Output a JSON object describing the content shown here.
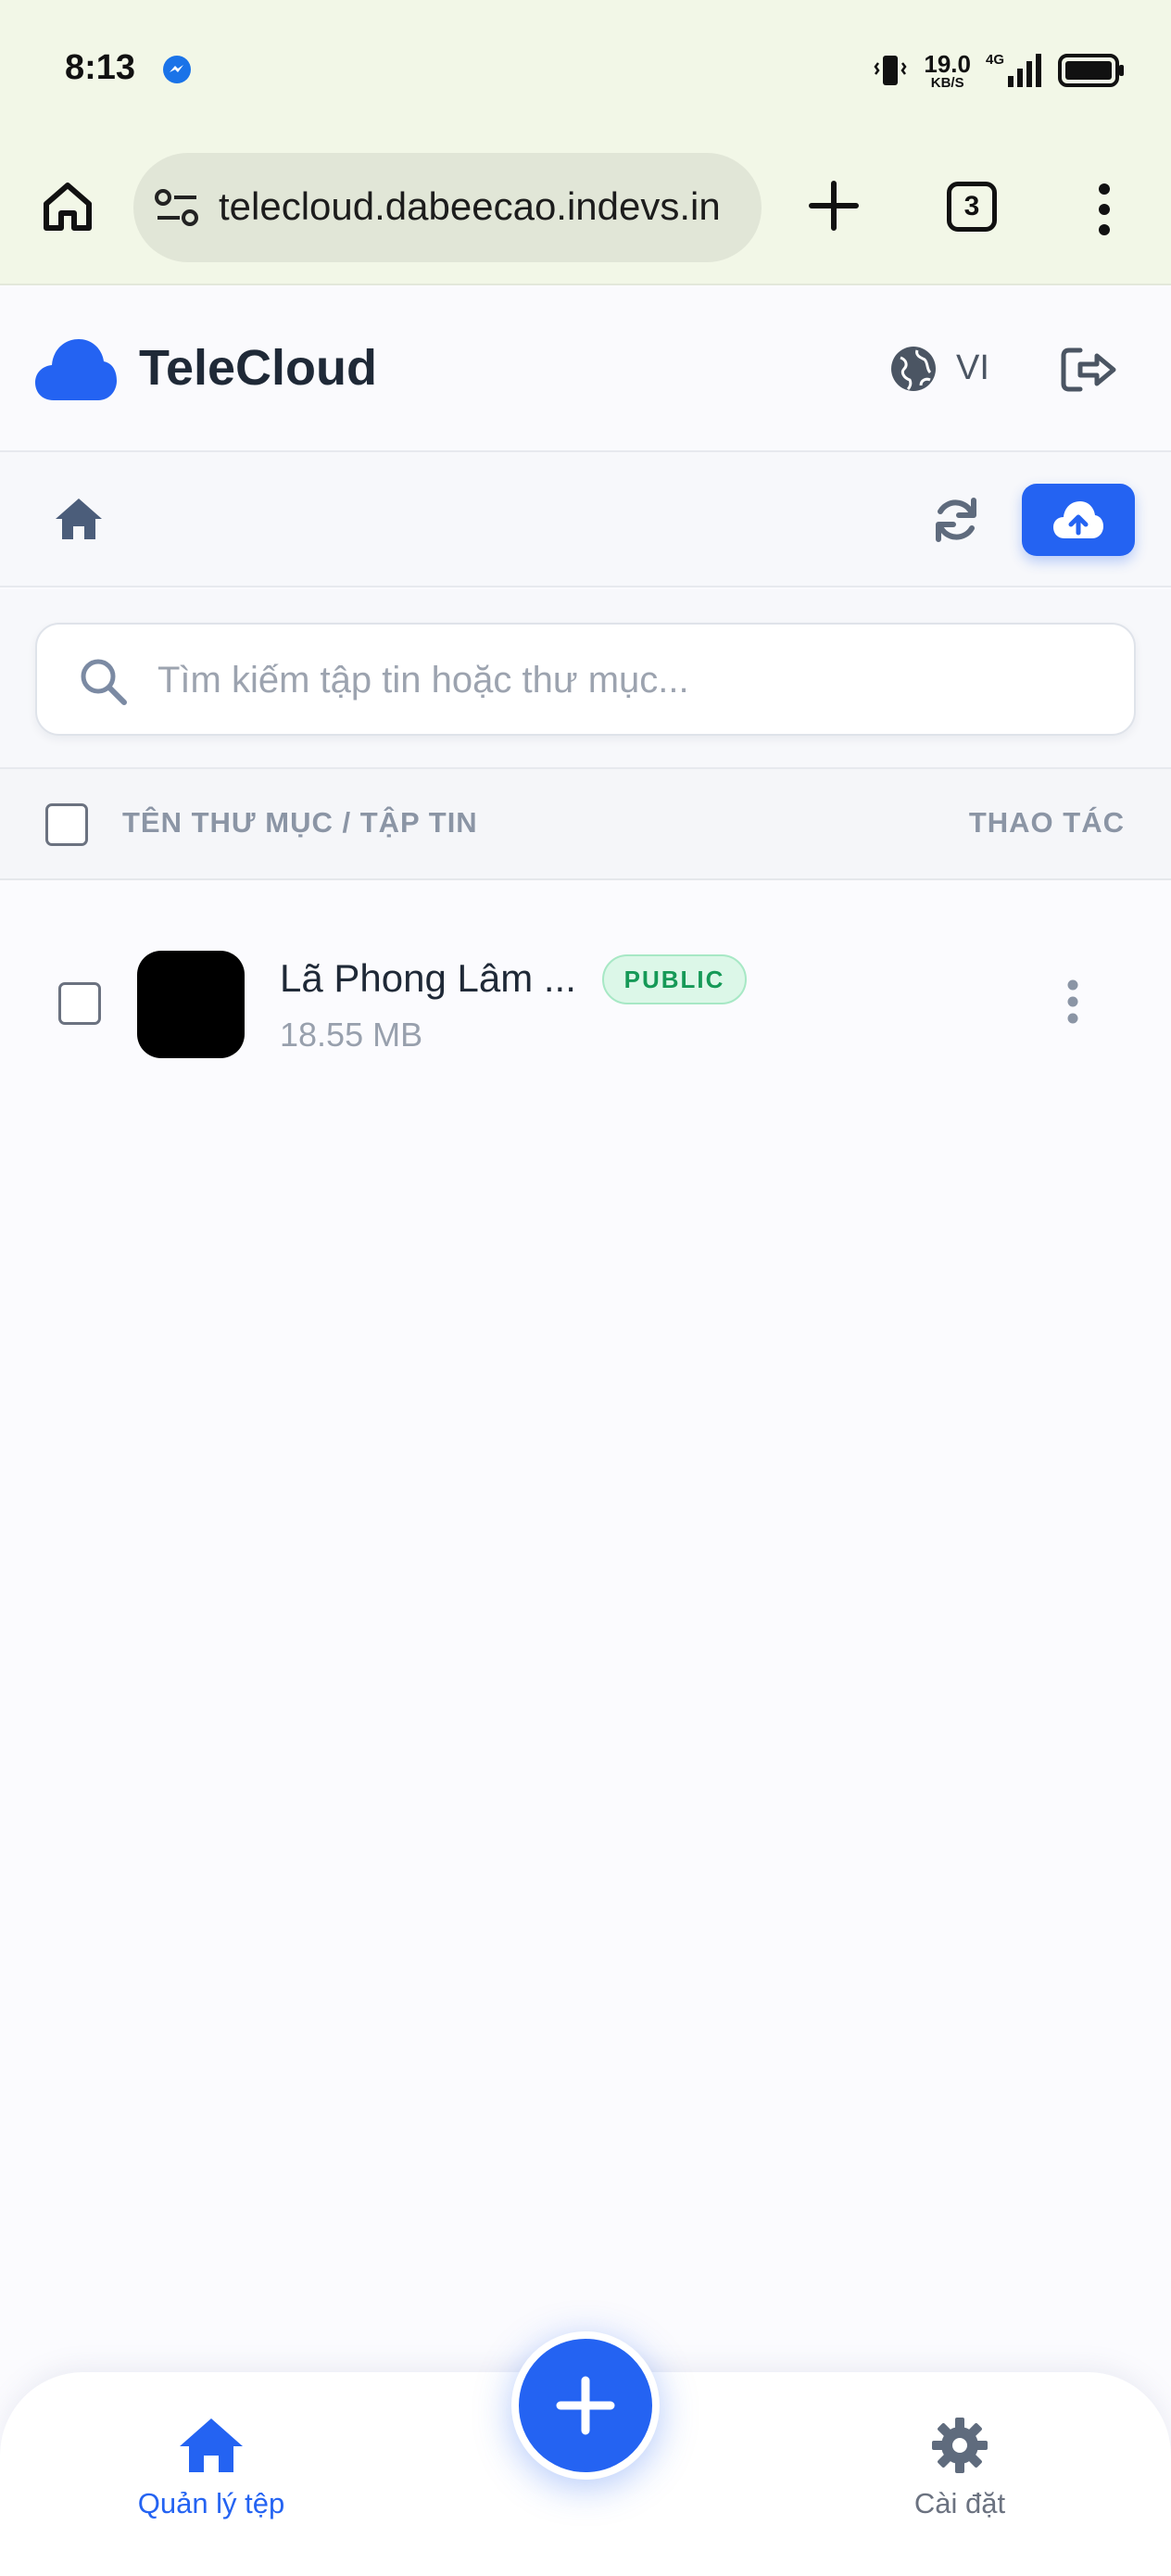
{
  "status_bar": {
    "time": "8:13",
    "net_speed_value": "19.0",
    "net_speed_unit": "KB/S",
    "network_type": "4G"
  },
  "browser": {
    "url": "telecloud.dabeecao.indevs.in",
    "tab_count": "3"
  },
  "header": {
    "brand": "TeleCloud",
    "language": "VI"
  },
  "search": {
    "placeholder": "Tìm kiếm tập tin hoặc thư mục..."
  },
  "table": {
    "col_name": "TÊN THƯ MỤC / TẬP TIN",
    "col_actions": "THAO TÁC",
    "rows": [
      {
        "name": "Lã Phong Lâm ...",
        "badge": "PUBLIC",
        "size": "18.55 MB"
      }
    ]
  },
  "bottom_nav": {
    "files_label": "Quản lý tệp",
    "settings_label": "Cài đặt"
  },
  "colors": {
    "accent": "#2463f2",
    "badge_green": "#159957",
    "browser_chrome": "#f2f7e7"
  }
}
